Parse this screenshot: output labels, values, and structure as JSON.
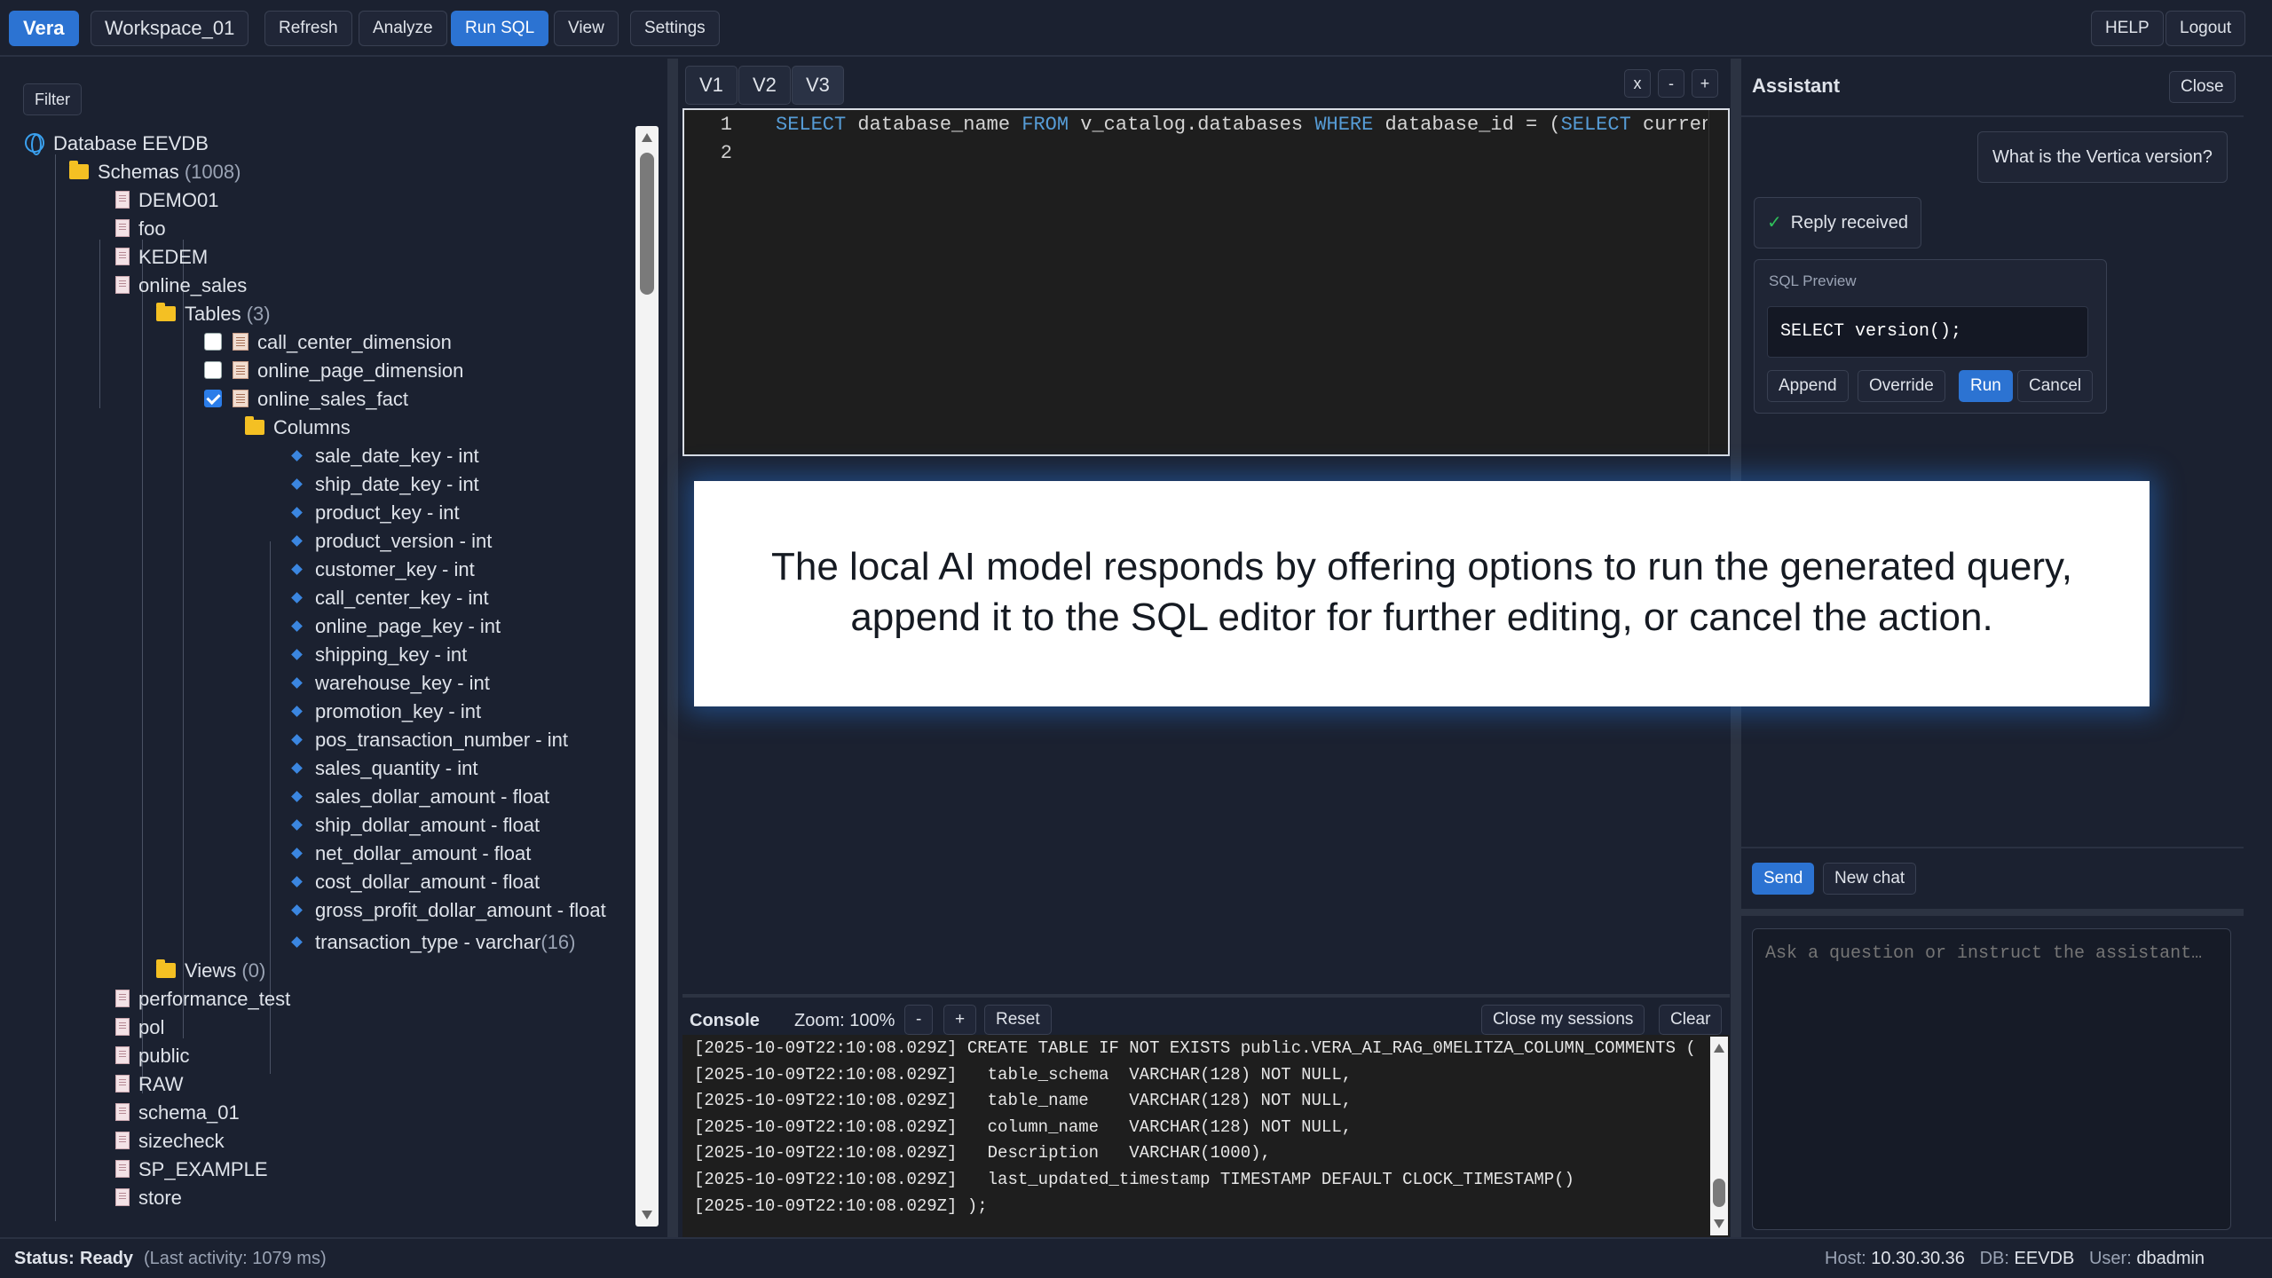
{
  "topbar": {
    "brand": "Vera",
    "workspace": "Workspace_01",
    "refresh": "Refresh",
    "analyze": "Analyze",
    "run_sql": "Run SQL",
    "view": "View",
    "settings": "Settings",
    "help": "HELP",
    "logout": "Logout"
  },
  "sidebar": {
    "filter": "Filter",
    "database": "Database EEVDB",
    "schemas_label": "Schemas",
    "schemas_count": "(1008)",
    "schemas_before": [
      "DEMO01",
      "foo",
      "KEDEM"
    ],
    "open_schema": "online_sales",
    "tables_label": "Tables",
    "tables_count": "(3)",
    "tables": [
      {
        "name": "call_center_dimension",
        "checked": false
      },
      {
        "name": "online_page_dimension",
        "checked": false
      },
      {
        "name": "online_sales_fact",
        "checked": true
      }
    ],
    "columns_label": "Columns",
    "columns": [
      "sale_date_key - int",
      "ship_date_key - int",
      "product_key - int",
      "product_version - int",
      "customer_key - int",
      "call_center_key - int",
      "online_page_key - int",
      "shipping_key - int",
      "warehouse_key - int",
      "promotion_key - int",
      "pos_transaction_number - int",
      "sales_quantity - int",
      "sales_dollar_amount - float",
      "ship_dollar_amount - float",
      "net_dollar_amount - float",
      "cost_dollar_amount - float",
      "gross_profit_dollar_amount - float"
    ],
    "last_column": "transaction_type - varchar",
    "last_column_len": "(16)",
    "views_label": "Views",
    "views_count": "(0)",
    "schemas_after": [
      "performance_test",
      "pol",
      "public",
      "RAW",
      "schema_01",
      "sizecheck",
      "SP_EXAMPLE",
      "store"
    ]
  },
  "editor": {
    "tabs": [
      "V1",
      "V2",
      "V3"
    ],
    "ctrl_close": "x",
    "ctrl_minus": "-",
    "ctrl_plus": "+",
    "line_numbers": [
      "1",
      "2"
    ],
    "code": {
      "k1": "SELECT",
      "t1": " database_name ",
      "k2": "FROM",
      "t2": " v_catalog.databases ",
      "k3": "WHERE",
      "t3": " database_id = (",
      "k4": "SELECT",
      "t4": " current_database_id()"
    }
  },
  "console": {
    "title": "Console",
    "zoom": "Zoom: 100%",
    "minus": "-",
    "plus": "+",
    "reset": "Reset",
    "close_sessions": "Close my sessions",
    "clear": "Clear",
    "lines": [
      "[2025-10-09T22:10:08.029Z] CREATE TABLE IF NOT EXISTS public.VERA_AI_RAG_0MELITZA_COLUMN_COMMENTS (",
      "[2025-10-09T22:10:08.029Z]   table_schema  VARCHAR(128) NOT NULL,",
      "[2025-10-09T22:10:08.029Z]   table_name    VARCHAR(128) NOT NULL,",
      "[2025-10-09T22:10:08.029Z]   column_name   VARCHAR(128) NOT NULL,",
      "[2025-10-09T22:10:08.029Z]   Description   VARCHAR(1000),",
      "[2025-10-09T22:10:08.029Z]   last_updated_timestamp TIMESTAMP DEFAULT CLOCK_TIMESTAMP()",
      "[2025-10-09T22:10:08.029Z] );"
    ]
  },
  "overlay": {
    "line1": "The local AI model responds by offering options to run the generated query,",
    "line2": "append it to the SQL editor for further editing, or cancel the action."
  },
  "assistant": {
    "title": "Assistant",
    "close": "Close",
    "user_message": "What is the Vertica version?",
    "check": "✓",
    "reply_status": "Reply received",
    "sql_preview_label": "SQL Preview",
    "sql_preview_code": "SELECT version();",
    "append": "Append",
    "override": "Override",
    "run": "Run",
    "cancel": "Cancel",
    "send": "Send",
    "new_chat": "New chat",
    "input_placeholder": "Ask a question or instruct the assistant…"
  },
  "status": {
    "label": "Status:",
    "value": "Ready",
    "activity": "(Last activity: 1079 ms)",
    "host_label": "Host:",
    "host": "10.30.30.36",
    "db_label": "DB:",
    "db": "EEVDB",
    "user_label": "User:",
    "user": "dbadmin"
  },
  "colors": {
    "accent": "#2c73d2",
    "background": "#1b2130",
    "editor_bg": "#1e1e1e",
    "keyword": "#569cd6"
  }
}
